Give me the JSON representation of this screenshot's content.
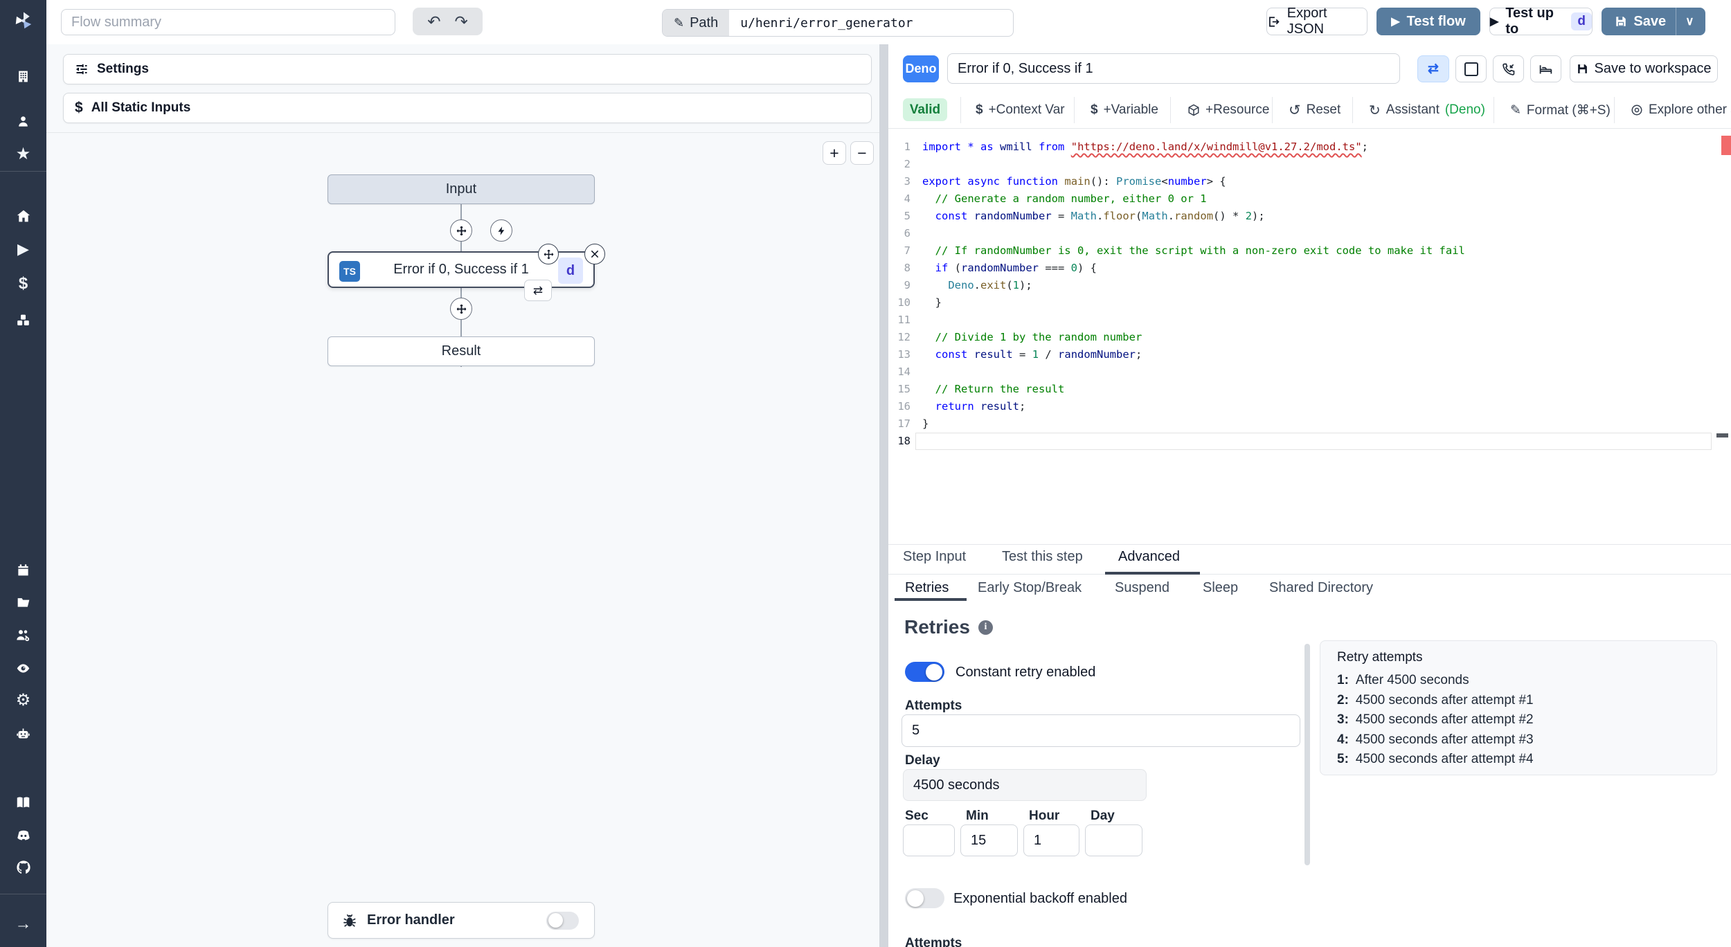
{
  "colors": {
    "sidebar_bg": "#2b3648",
    "steel_blue": "#587c9e",
    "deno_blue": "#3b82f6",
    "valid_green_bg": "#d4f4e0",
    "valid_green_text": "#15803d",
    "badge_indigo_bg": "#e0e7ff",
    "badge_indigo_text": "#4338ca",
    "toggle_on": "#2563eb"
  },
  "topbar": {
    "flow_summary_placeholder": "Flow summary",
    "path_label": "Path",
    "path_value": "u/henri/error_generator",
    "export_json": "Export JSON",
    "test_flow": "Test flow",
    "test_up_to": "Test up to",
    "test_up_to_badge": "d",
    "save": "Save"
  },
  "sidebar": {
    "icons": [
      "windmill-logo",
      "building",
      "user",
      "star",
      "home",
      "play",
      "dollar",
      "cubes",
      "calendar",
      "folder",
      "users-cog",
      "eye",
      "gear",
      "bot",
      "book",
      "discord",
      "github",
      "expand-arrow"
    ]
  },
  "left_panel": {
    "settings": "Settings",
    "all_static_inputs": "All Static Inputs",
    "zoom_in": "+",
    "zoom_out": "−"
  },
  "flow": {
    "input_node": "Input",
    "step_label": "Error if 0, Success if 1",
    "step_lang_badge": "TS",
    "step_suffix_badge": "d",
    "result_node": "Result",
    "error_handler": "Error handler"
  },
  "editor_header": {
    "lang_badge": "Deno",
    "summary_value": "Error if 0, Success if 1",
    "save_to_workspace": "Save to workspace"
  },
  "editor_toolbar": {
    "valid": "Valid",
    "context_var": "+Context Var",
    "variable": "+Variable",
    "resource": "+Resource",
    "reset": "Reset",
    "assistant": "Assistant",
    "assistant_lang": "(Deno)",
    "format": "Format (⌘+S)",
    "explore": "Explore other s"
  },
  "code": {
    "lines": [
      [
        [
          "kw",
          "import"
        ],
        [
          "pl",
          " "
        ],
        [
          "kw",
          "*"
        ],
        [
          "pl",
          " "
        ],
        [
          "kw",
          "as"
        ],
        [
          "pl",
          " "
        ],
        [
          "var",
          "wmill"
        ],
        [
          "pl",
          " "
        ],
        [
          "kw",
          "from"
        ],
        [
          "pl",
          " "
        ],
        [
          "sq",
          "\"https://deno.land/x/windmill@v1.27.2/mod.ts\""
        ],
        [
          "pl",
          ";"
        ]
      ],
      [],
      [
        [
          "kw",
          "export"
        ],
        [
          "pl",
          " "
        ],
        [
          "kw",
          "async"
        ],
        [
          "pl",
          " "
        ],
        [
          "kw",
          "function"
        ],
        [
          "pl",
          " "
        ],
        [
          "fn",
          "main"
        ],
        [
          "pl",
          "(): "
        ],
        [
          "ty",
          "Promise"
        ],
        [
          "pl",
          "<"
        ],
        [
          "kw",
          "number"
        ],
        [
          "pl",
          "> {"
        ]
      ],
      [
        [
          "cm",
          "  // Generate a random number, either 0 or 1"
        ]
      ],
      [
        [
          "pl",
          "  "
        ],
        [
          "kw",
          "const"
        ],
        [
          "pl",
          " "
        ],
        [
          "var",
          "randomNumber"
        ],
        [
          "pl",
          " = "
        ],
        [
          "ty",
          "Math"
        ],
        [
          "pl",
          "."
        ],
        [
          "fn",
          "floor"
        ],
        [
          "pl",
          "("
        ],
        [
          "ty",
          "Math"
        ],
        [
          "pl",
          "."
        ],
        [
          "fn",
          "random"
        ],
        [
          "pl",
          "() * "
        ],
        [
          "num",
          "2"
        ],
        [
          "pl",
          ");"
        ]
      ],
      [],
      [
        [
          "cm",
          "  // If randomNumber is 0, exit the script with a non-zero exit code to make it fail"
        ]
      ],
      [
        [
          "pl",
          "  "
        ],
        [
          "kw",
          "if"
        ],
        [
          "pl",
          " ("
        ],
        [
          "var",
          "randomNumber"
        ],
        [
          "pl",
          " === "
        ],
        [
          "num",
          "0"
        ],
        [
          "pl",
          ") {"
        ]
      ],
      [
        [
          "pl",
          "    "
        ],
        [
          "ty",
          "Deno"
        ],
        [
          "pl",
          "."
        ],
        [
          "fn",
          "exit"
        ],
        [
          "pl",
          "("
        ],
        [
          "num",
          "1"
        ],
        [
          "pl",
          ");"
        ]
      ],
      [
        [
          "pl",
          "  }"
        ]
      ],
      [],
      [
        [
          "cm",
          "  // Divide 1 by the random number"
        ]
      ],
      [
        [
          "pl",
          "  "
        ],
        [
          "kw",
          "const"
        ],
        [
          "pl",
          " "
        ],
        [
          "var",
          "result"
        ],
        [
          "pl",
          " = "
        ],
        [
          "num",
          "1"
        ],
        [
          "pl",
          " / "
        ],
        [
          "var",
          "randomNumber"
        ],
        [
          "pl",
          ";"
        ]
      ],
      [],
      [
        [
          "cm",
          "  // Return the result"
        ]
      ],
      [
        [
          "pl",
          "  "
        ],
        [
          "kw",
          "return"
        ],
        [
          "pl",
          " "
        ],
        [
          "var",
          "result"
        ],
        [
          "pl",
          ";"
        ]
      ],
      [
        [
          "pl",
          "}"
        ]
      ],
      []
    ],
    "current_line": 18
  },
  "tabs": {
    "row1": [
      "Step Input",
      "Test this step",
      "Advanced"
    ],
    "row1_active": "Advanced",
    "row2": [
      "Retries",
      "Early Stop/Break",
      "Suspend",
      "Sleep",
      "Shared Directory"
    ],
    "row2_active": "Retries"
  },
  "retries": {
    "title": "Retries",
    "constant_toggle_label": "Constant retry enabled",
    "attempts_label": "Attempts",
    "attempts_value": "5",
    "delay_label": "Delay",
    "delay_value": "4500 seconds",
    "sec_label": "Sec",
    "min_label": "Min",
    "hour_label": "Hour",
    "day_label": "Day",
    "sec_value": "",
    "min_value": "15",
    "hour_value": "1",
    "day_value": "",
    "exponential_toggle_label": "Exponential backoff enabled",
    "attempts2_label": "Attempts",
    "panel": {
      "title": "Retry attempts",
      "items": [
        {
          "n": "1:",
          "text": "After 4500 seconds"
        },
        {
          "n": "2:",
          "text": "4500 seconds after attempt #1"
        },
        {
          "n": "3:",
          "text": "4500 seconds after attempt #2"
        },
        {
          "n": "4:",
          "text": "4500 seconds after attempt #3"
        },
        {
          "n": "5:",
          "text": "4500 seconds after attempt #4"
        }
      ]
    }
  }
}
